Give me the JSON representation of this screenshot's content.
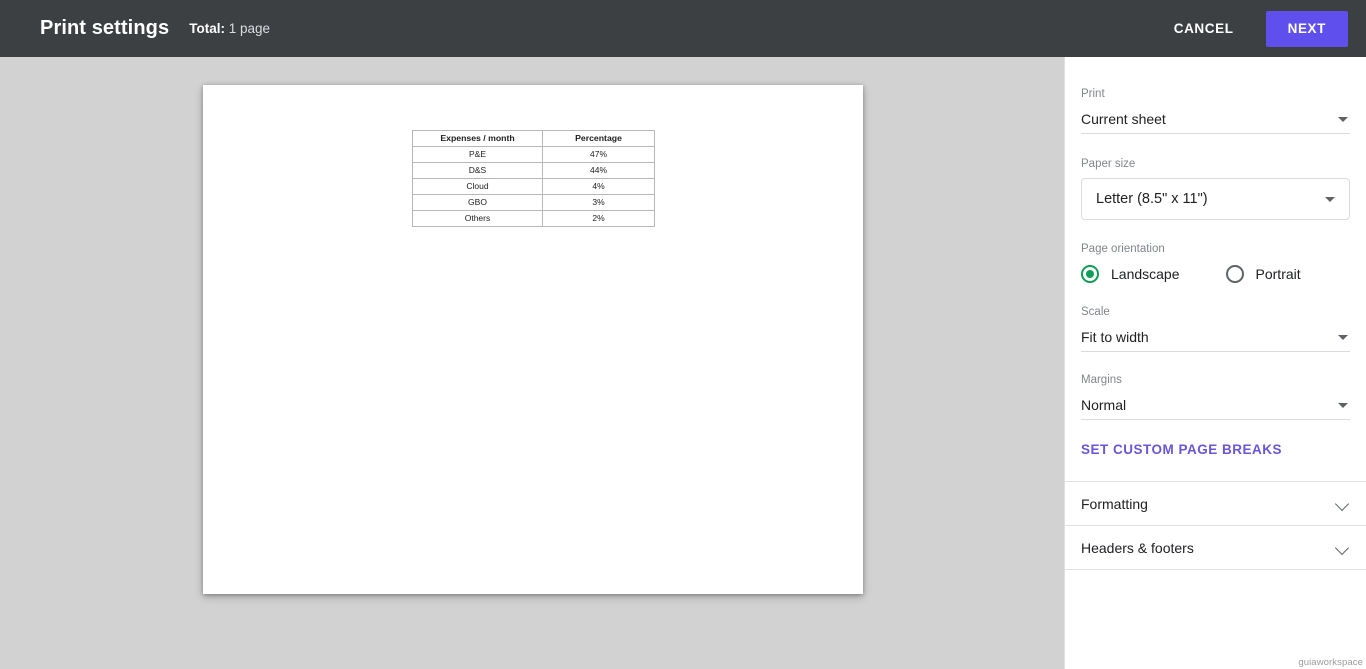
{
  "topbar": {
    "title": "Print settings",
    "total_label": "Total:",
    "total_value": "1 page",
    "cancel_label": "CANCEL",
    "next_label": "NEXT",
    "background_color": "#3c4043",
    "next_color": "#5f4fec"
  },
  "preview": {
    "table": {
      "headers": [
        "Expenses / month",
        "Percentage"
      ],
      "rows": [
        [
          "P&E",
          "47%"
        ],
        [
          "D&S",
          "44%"
        ],
        [
          "Cloud",
          "4%"
        ],
        [
          "GBO",
          "3%"
        ],
        [
          "Others",
          "2%"
        ]
      ]
    }
  },
  "sidebar": {
    "print": {
      "label": "Print",
      "value": "Current sheet"
    },
    "paper_size": {
      "label": "Paper size",
      "value": "Letter (8.5\" x 11\")"
    },
    "page_orientation": {
      "label": "Page orientation",
      "options": [
        {
          "label": "Landscape",
          "selected": true
        },
        {
          "label": "Portrait",
          "selected": false
        }
      ],
      "selected_color": "#0f9d58"
    },
    "scale": {
      "label": "Scale",
      "value": "Fit to width"
    },
    "margins": {
      "label": "Margins",
      "value": "Normal"
    },
    "page_breaks_link": "SET CUSTOM PAGE BREAKS",
    "accordions": [
      {
        "label": "Formatting"
      },
      {
        "label": "Headers & footers"
      }
    ]
  },
  "watermark": "guiaworkspace"
}
